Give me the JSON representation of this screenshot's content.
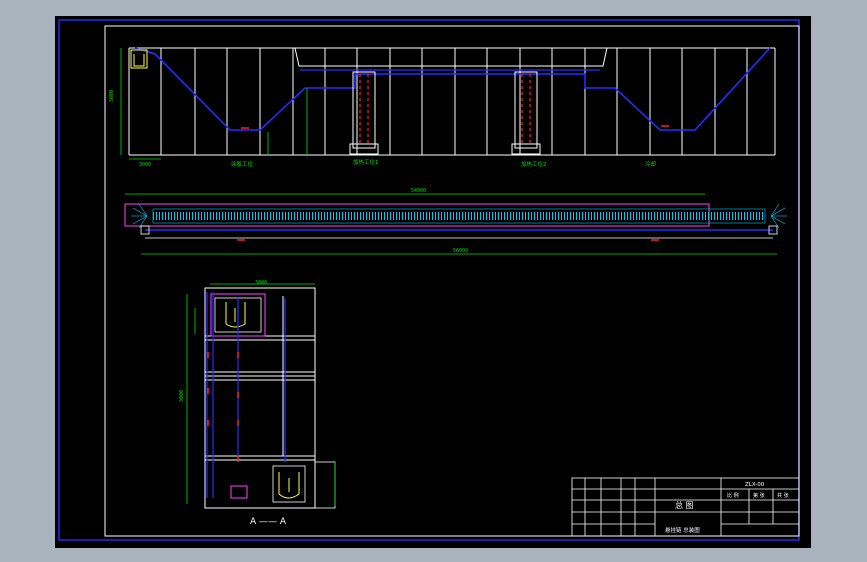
{
  "labels": {
    "station_1": "加热工位1",
    "station_2": "加热工位2",
    "left_station": "涂胶工位",
    "right_station": "冷却",
    "section": "A —— A",
    "dim_top": "3000",
    "dim_long": "54000",
    "dim_long_bottom": "56000",
    "dim_frame_h": "3000",
    "dim_frame_w": "3000"
  },
  "title_block": {
    "drawing_name": "总 图",
    "drawing_no": "ZLX-00",
    "scale_label": "比 例",
    "sheet_label": "第 张",
    "material_label": "共 张",
    "company": "悬挂链 总装图"
  },
  "colors": {
    "background": "#000000",
    "frame": "#ffffff",
    "conveyor": "#2a2aff",
    "dimension": "#00e000",
    "accent_red": "#ff2020",
    "chain": "#00c8ff",
    "magenta": "#ff40ff",
    "yellow": "#ffff40"
  }
}
